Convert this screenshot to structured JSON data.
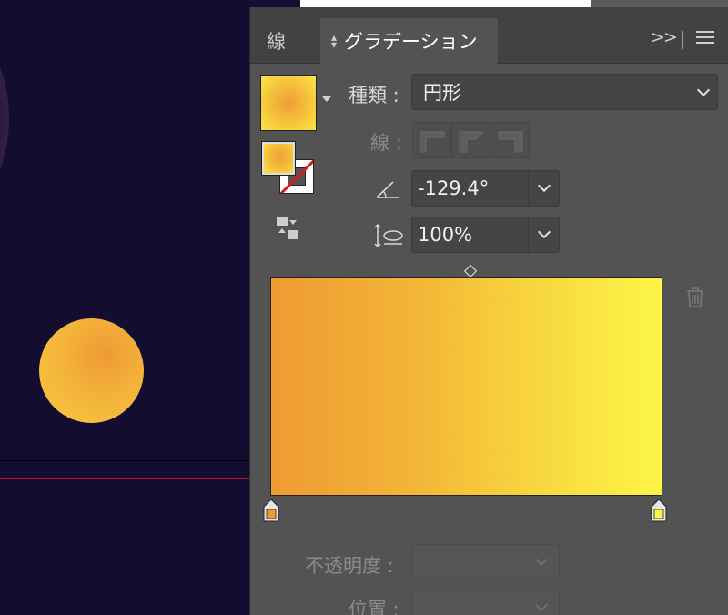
{
  "panel": {
    "tabs": [
      {
        "label": "線"
      },
      {
        "label": "グラデーション"
      }
    ],
    "expand_icon": "double-chevron-right-icon",
    "menu_icon": "hamburger-menu-icon"
  },
  "gradient": {
    "type_label": "種類 :",
    "type_value": "円形",
    "stroke_label": "線 :",
    "angle_value": "-129.4°",
    "aspect_value": "100%",
    "opacity_label": "不透明度 :",
    "position_label": "位置 :",
    "stops": [
      {
        "color": "#ef9a33"
      },
      {
        "color": "#fdf448"
      }
    ]
  },
  "colors": {
    "canvas": "#120d31",
    "panel": "#535353",
    "guide": "#c3112a"
  }
}
